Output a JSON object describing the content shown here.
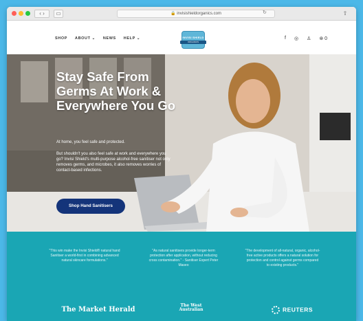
{
  "browser": {
    "url": "invisishieldorganics.com",
    "back_label": "‹ ›",
    "sidebar_label": "▭",
    "reload_label": "↻",
    "share_label": "⇧"
  },
  "header": {
    "nav": [
      "SHOP",
      "ABOUT ⌄",
      "NEWS",
      "HELP ⌄"
    ],
    "logo_text": "INVISI SHIELD",
    "logo_band": "ORGANICS",
    "icons": [
      "f",
      "◎",
      "♙",
      "⊛ 0"
    ]
  },
  "hero": {
    "title": "Stay Safe From Germs At Work & Everywhere You Go",
    "para1": "At home, you feel safe and protected.",
    "para2": "But shouldn't you also feel safe at work and everywhere you go? Invisi Shield's multi-purpose alcohol-free sanitiser not only removes germs, and microbes, it also removes worries of contact-based infections.",
    "cta": "Shop Hand Sanitisers"
  },
  "press": {
    "quotes": [
      "\"This win make the Invisi Shield® natural hand Sanitiser a world-first in combining advanced natural skincare formulations.\"",
      "\"As natural sanitisers provide longer-term protection after application, without reducing cross contamination.\" - Sanitiser Expert Peter Maseo",
      "\"The development of all-natural, organic, alcohol-free active products offers a natural solution for protection and control against germs compared to existing products.\""
    ],
    "outlets": [
      "The Market Herald",
      "The West Australian",
      "REUTERS"
    ]
  },
  "colors": {
    "page_bg": "#4cb8e8",
    "cta": "#14347a",
    "press_band": "#1aa6b4"
  }
}
